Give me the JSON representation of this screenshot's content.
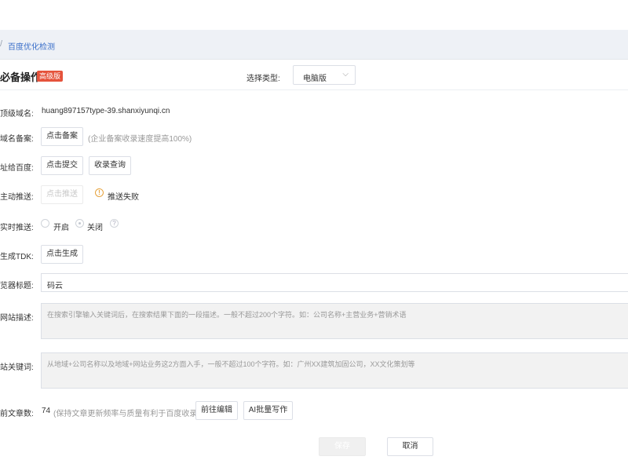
{
  "breadcrumb": {
    "separator": "/",
    "current": "百度优化检测"
  },
  "section": {
    "title": "必备操作",
    "badge": "高级版"
  },
  "type_select": {
    "label": "选择类型:",
    "value": "电脑版",
    "chevron": "⌵"
  },
  "rows": {
    "domain": {
      "label": "顶级域名:",
      "value": "huang897157type-39.shanxiyunqi.cn"
    },
    "icp": {
      "label": "域名备案:",
      "button": "点击备案",
      "hint": "(企业备案收录速度提高100%)"
    },
    "submit_baidu": {
      "label": "址给百度:",
      "submit_button": "点击提交",
      "query_button": "收录查询"
    },
    "active_push": {
      "label": "主动推送:",
      "button": "点击推送",
      "warn_icon": "!",
      "status": "推送失败"
    },
    "realtime_push": {
      "label": "实时推送:",
      "on_label": "开启",
      "off_label": "关闭",
      "help_icon": "?"
    },
    "tdk": {
      "label": "生成TDK:",
      "button": "点击生成"
    },
    "browser_title": {
      "label": "览器标题:",
      "value": "码云"
    },
    "description": {
      "label": "网站描述:",
      "placeholder": "在搜索引擎输入关键词后，在搜索结果下面的一段描述。一般不超过200个字符。如：公司名称+主营业务+营销术语"
    },
    "keywords": {
      "label": "站关键词:",
      "placeholder": "从地域+公司名称以及地域+网站业务这2方面入手，一般不超过100个字符。如：广州XX建筑加固公司，XX文化策划等"
    },
    "articles": {
      "label": "前文章数:",
      "count": "74",
      "hint": "(保持文章更新频率与质量有利于百度收录)",
      "edit_button": "前往编辑",
      "ai_button": "AI批量写作"
    }
  },
  "actions": {
    "save": "保存",
    "cancel": "取消"
  },
  "colors": {
    "accent": "#3a6fc9",
    "badge": "#e5533c",
    "warning": "#e6a23c"
  }
}
